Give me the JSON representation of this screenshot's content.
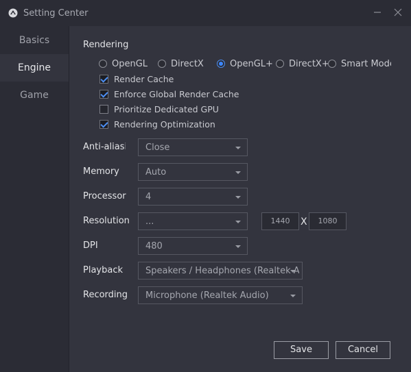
{
  "window": {
    "title": "Setting Center",
    "app_icon": "app-logo-icon",
    "minimize_icon": "minimize-icon",
    "close_icon": "close-icon"
  },
  "sidebar": {
    "items": [
      {
        "label": "Basics",
        "active": false
      },
      {
        "label": "Engine",
        "active": true
      },
      {
        "label": "Game",
        "active": false
      }
    ]
  },
  "rendering": {
    "title": "Rendering",
    "modes": [
      {
        "label": "OpenGL",
        "checked": false
      },
      {
        "label": "DirectX",
        "checked": false
      },
      {
        "label": "OpenGL+",
        "checked": true
      },
      {
        "label": "DirectX+",
        "checked": false
      },
      {
        "label": "Smart Mode",
        "checked": false
      }
    ],
    "options": [
      {
        "label": "Render Cache",
        "checked": true
      },
      {
        "label": "Enforce Global Render Cache",
        "checked": true
      },
      {
        "label": "Prioritize Dedicated GPU",
        "checked": false
      },
      {
        "label": "Rendering Optimization",
        "checked": true
      }
    ]
  },
  "fields": {
    "anti_aliasing": {
      "label": "Anti-aliasing",
      "value": "Close"
    },
    "memory": {
      "label": "Memory",
      "value": "Auto"
    },
    "processor": {
      "label": "Processor",
      "value": "4"
    },
    "resolution": {
      "label": "Resolution",
      "value": "...",
      "width": "1440",
      "height": "1080",
      "separator": "X"
    },
    "dpi": {
      "label": "DPI",
      "value": "480"
    },
    "playback": {
      "label": "Playback",
      "value": "Speakers / Headphones (Realtek Audio)"
    },
    "recording": {
      "label": "Recording",
      "value": "Microphone (Realtek Audio)"
    }
  },
  "actions": {
    "save_label": "Save",
    "cancel_label": "Cancel"
  },
  "colors": {
    "accent": "#3d87ff",
    "background": "#33343e",
    "sidebar": "#2b2c35"
  }
}
